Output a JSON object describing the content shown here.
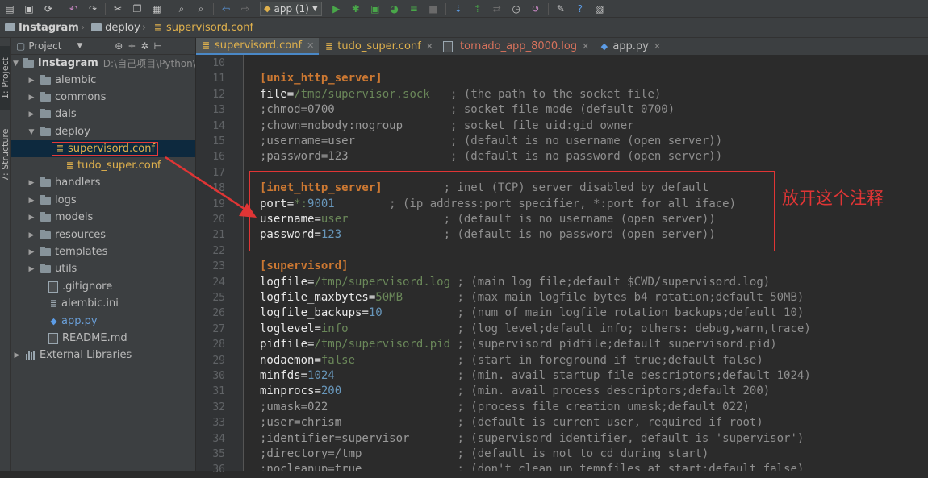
{
  "toolbar": {
    "run_config": "app (1)",
    "icons": [
      "save-icon",
      "sync-icon",
      "undo-icon",
      "redo-icon",
      "cut-icon",
      "copy-icon",
      "paste-icon",
      "find-icon",
      "replace-icon",
      "back-icon",
      "forward-icon",
      "run-icon",
      "debug-icon",
      "coverage-icon",
      "profile-icon",
      "build-icon",
      "stop-icon",
      "vcs-update-icon",
      "vcs-commit-icon",
      "vcs-compare-icon",
      "vcs-history-icon",
      "vcs-revert-icon",
      "settings-icon",
      "help-icon",
      "sdk-icon"
    ]
  },
  "breadcrumb": {
    "root": "Instagram",
    "folder": "deploy",
    "file": "supervisord.conf"
  },
  "side_tabs": {
    "project": "1: Project",
    "structure": "7: Structure"
  },
  "project_panel": {
    "header": "Project",
    "root_name": "Instagram",
    "root_path": "D:\\自己项目\\Python\\I",
    "items": [
      {
        "label": "alembic",
        "kind": "folder",
        "expanded": false
      },
      {
        "label": "commons",
        "kind": "folder",
        "expanded": false
      },
      {
        "label": "dals",
        "kind": "folder",
        "expanded": false
      },
      {
        "label": "deploy",
        "kind": "folder",
        "expanded": true
      },
      {
        "label": "supervisord.conf",
        "kind": "conf",
        "selected": true
      },
      {
        "label": "tudo_super.conf",
        "kind": "conf"
      },
      {
        "label": "handlers",
        "kind": "folder",
        "expanded": false
      },
      {
        "label": "logs",
        "kind": "folder",
        "expanded": false
      },
      {
        "label": "models",
        "kind": "folder",
        "expanded": false
      },
      {
        "label": "resources",
        "kind": "folder",
        "expanded": false
      },
      {
        "label": "templates",
        "kind": "folder",
        "expanded": false
      },
      {
        "label": "utils",
        "kind": "folder",
        "expanded": false
      },
      {
        "label": ".gitignore",
        "kind": "file"
      },
      {
        "label": "alembic.ini",
        "kind": "file"
      },
      {
        "label": "app.py",
        "kind": "file"
      },
      {
        "label": "README.md",
        "kind": "file"
      }
    ],
    "external_libraries": "External Libraries"
  },
  "editor_tabs": [
    {
      "label": "supervisord.conf",
      "active": true
    },
    {
      "label": "tudo_super.conf",
      "active": false
    },
    {
      "label": "tornado_app_8000.log",
      "active": false
    },
    {
      "label": "app.py",
      "active": false
    }
  ],
  "code_lines": [
    {
      "n": "10",
      "text": ""
    },
    {
      "n": "11",
      "text": "[unix_http_server]"
    },
    {
      "n": "12",
      "text": "file=/tmp/supervisor.sock   ; (the path to the socket file)"
    },
    {
      "n": "13",
      "text": ";chmod=0700                 ; socket file mode (default 0700)"
    },
    {
      "n": "14",
      "text": ";chown=nobody:nogroup       ; socket file uid:gid owner"
    },
    {
      "n": "15",
      "text": ";username=user              ; (default is no username (open server))"
    },
    {
      "n": "16",
      "text": ";password=123               ; (default is no password (open server))"
    },
    {
      "n": "17",
      "text": ""
    },
    {
      "n": "18",
      "text": "[inet_http_server]         ; inet (TCP) server disabled by default"
    },
    {
      "n": "19",
      "text": "port=*:9001        ; (ip_address:port specifier, *:port for all iface)"
    },
    {
      "n": "20",
      "text": "username=user              ; (default is no username (open server))"
    },
    {
      "n": "21",
      "text": "password=123               ; (default is no password (open server))"
    },
    {
      "n": "22",
      "text": ""
    },
    {
      "n": "23",
      "text": "[supervisord]"
    },
    {
      "n": "24",
      "text": "logfile=/tmp/supervisord.log ; (main log file;default $CWD/supervisord.log)"
    },
    {
      "n": "25",
      "text": "logfile_maxbytes=50MB        ; (max main logfile bytes b4 rotation;default 50MB)"
    },
    {
      "n": "26",
      "text": "logfile_backups=10           ; (num of main logfile rotation backups;default 10)"
    },
    {
      "n": "27",
      "text": "loglevel=info                ; (log level;default info; others: debug,warn,trace)"
    },
    {
      "n": "28",
      "text": "pidfile=/tmp/supervisord.pid ; (supervisord pidfile;default supervisord.pid)"
    },
    {
      "n": "29",
      "text": "nodaemon=false               ; (start in foreground if true;default false)"
    },
    {
      "n": "30",
      "text": "minfds=1024                  ; (min. avail startup file descriptors;default 1024)"
    },
    {
      "n": "31",
      "text": "minprocs=200                 ; (min. avail process descriptors;default 200)"
    },
    {
      "n": "32",
      "text": ";umask=022                   ; (process file creation umask;default 022)"
    },
    {
      "n": "33",
      "text": ";user=chrism                 ; (default is current user, required if root)"
    },
    {
      "n": "34",
      "text": ";identifier=supervisor       ; (supervisord identifier, default is 'supervisor')"
    },
    {
      "n": "35",
      "text": ";directory=/tmp              ; (default is not to cd during start)"
    },
    {
      "n": "36",
      "text": ";nocleanup=true              ; (don't clean up tempfiles at start;default false)"
    }
  ],
  "annotation": {
    "text": "放开这个注释",
    "color": "#e03535"
  },
  "colors": {
    "section": "#cc7832",
    "value": "#6a8759",
    "number": "#6897bb",
    "comment": "#8e8e8e",
    "highlight": "#e03535"
  }
}
